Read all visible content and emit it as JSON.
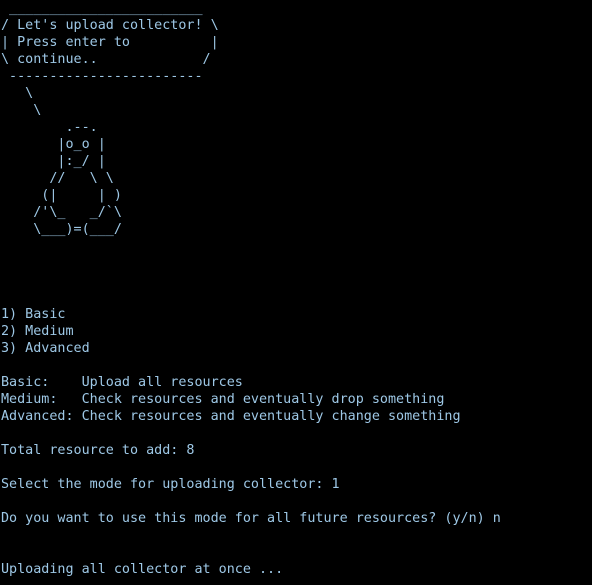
{
  "banner": {
    "lines": [
      " ________________________",
      "/ Let's upload collector! \\",
      "| Press enter to          |",
      "\\ continue..             /",
      " ------------------------",
      "   \\",
      "    \\",
      "        .--.",
      "       |o_o |",
      "       |:_/ |",
      "      //   \\ \\",
      "     (|     | )",
      "    /'\\_   _/`\\",
      "    \\___)=(___/"
    ]
  },
  "menu": {
    "options": [
      "1) Basic",
      "2) Medium",
      "3) Advanced"
    ]
  },
  "descriptions": [
    "Basic:    Upload all resources",
    "Medium:   Check resources and eventually drop something",
    "Advanced: Check resources and eventually change something"
  ],
  "total_line": "Total resource to add: 8",
  "select_prompt": "Select the mode for uploading collector: 1",
  "future_prompt": "Do you want to use this mode for all future resources? (y/n) n",
  "status_line": "Uploading all collector at once ...",
  "colors": {
    "background": "#000000",
    "text": "#9ec8e6"
  }
}
